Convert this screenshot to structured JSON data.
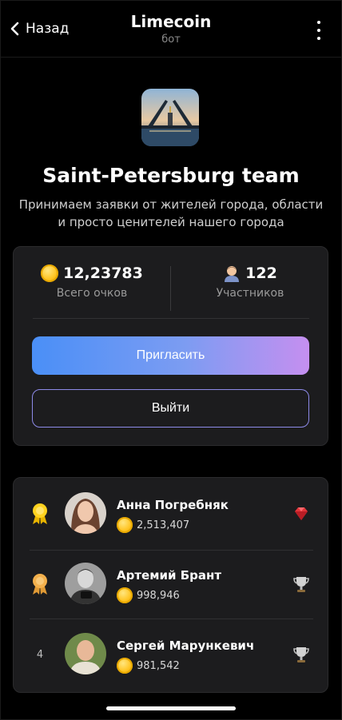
{
  "header": {
    "back_label": "Назад",
    "title": "Limecoin",
    "subtitle": "бот"
  },
  "team": {
    "name": "Saint-Petersburg team",
    "description_line1": "Принимаем заявки от жителей города, области",
    "description_line2": "и просто ценителей нашего города"
  },
  "stats": {
    "points_value": "12,23783",
    "points_label": "Всего очков",
    "members_value": "122",
    "members_label": "Участников"
  },
  "actions": {
    "invite_label": "Пригласить",
    "exit_label": "Выйти"
  },
  "leaderboard": [
    {
      "rank": "",
      "rank_icon": "gold-ribbon-icon",
      "name": "Анна Погребняк",
      "points": "2,513,407",
      "badge_icon": "red-gem-icon"
    },
    {
      "rank": "",
      "rank_icon": "bronze-ribbon-icon",
      "name": "Артемий Брант",
      "points": "998,946",
      "badge_icon": "silver-cup-icon"
    },
    {
      "rank": "4",
      "rank_icon": "",
      "name": "Сергей Марункевич",
      "points": "981,542",
      "badge_icon": "silver-cup-icon"
    }
  ],
  "colors": {
    "background": "#000000",
    "card": "#1c1c1e",
    "coin": "#ffc422",
    "invite_gradient_start": "#4a8ff7",
    "invite_gradient_end": "#c58ff0",
    "exit_border": "#8d8ae8"
  }
}
